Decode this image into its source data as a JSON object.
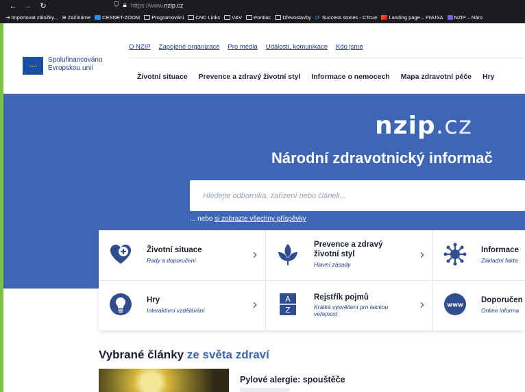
{
  "browser": {
    "url_prefix": "https://www.",
    "url_domain": "nzip.cz",
    "bookmarks": [
      {
        "label": "Importovat záložky...",
        "icon": "import-icon"
      },
      {
        "label": "Začínáme",
        "icon": "globe-icon"
      },
      {
        "label": "CESNET-ZOOM",
        "icon": "zoom-icon"
      },
      {
        "label": "Programování",
        "icon": "folder-icon"
      },
      {
        "label": "CNC Links",
        "icon": "folder-icon"
      },
      {
        "label": "V&V",
        "icon": "folder-icon"
      },
      {
        "label": "Pontiac",
        "icon": "folder-icon"
      },
      {
        "label": "Dřevostavby",
        "icon": "folder-icon"
      },
      {
        "label": "Success stories - CTcue",
        "icon": "ctcue-icon"
      },
      {
        "label": "Landing page – FNUSA",
        "icon": "fnusa-icon"
      },
      {
        "label": "NZIP – Náro",
        "icon": "nzip-icon"
      }
    ]
  },
  "header": {
    "eu_line1": "Spolufinancováno",
    "eu_line2": "Evropskou unií",
    "top_links": [
      "O NZIP",
      "Zapojené organizace",
      "Pro média",
      "Události, komunikace",
      "Kdo jsme"
    ],
    "menu": [
      "Životní situace",
      "Prevence a zdravý životní styl",
      "Informace o nemocech",
      "Mapa zdravotní péče",
      "Hry"
    ]
  },
  "hero": {
    "logo_main": "nzip",
    "logo_tld": ".cz",
    "title": "Národní zdravotnický informač",
    "search_placeholder": "Hledejte odborníka, zařízení nebo článek...",
    "see_all_prefix": "... nebo ",
    "see_all_link": "si zobrazte všechny příspěvky"
  },
  "cards": [
    {
      "title": "Životní situace",
      "subtitle": "Rady a doporučení",
      "icon": "heart-plus-icon"
    },
    {
      "title": "Prevence a zdravý životní styl",
      "subtitle": "Hlavní zásady",
      "icon": "leaf-icon"
    },
    {
      "title": "Informace",
      "subtitle": "Základní fakta",
      "icon": "virus-icon"
    },
    {
      "title": "Hry",
      "subtitle": "Interaktivní vzdělávání",
      "icon": "lightbulb-icon"
    },
    {
      "title": "Rejstřík pojmů",
      "subtitle": "Krátká vysvětlení pro laickou veřejnost",
      "icon": "az-icon"
    },
    {
      "title": "Doporučen",
      "subtitle": "Online informa",
      "icon": "www-icon"
    }
  ],
  "articles": {
    "heading_dark": "Vybrané články ",
    "heading_accent": "ze světa zdraví",
    "items": [
      {
        "title": "Pylové alergie: spouštěče"
      }
    ]
  },
  "colors": {
    "brand_blue": "#3f66b5",
    "dark_text": "#1a1f36",
    "link_blue": "#1f3a93"
  }
}
